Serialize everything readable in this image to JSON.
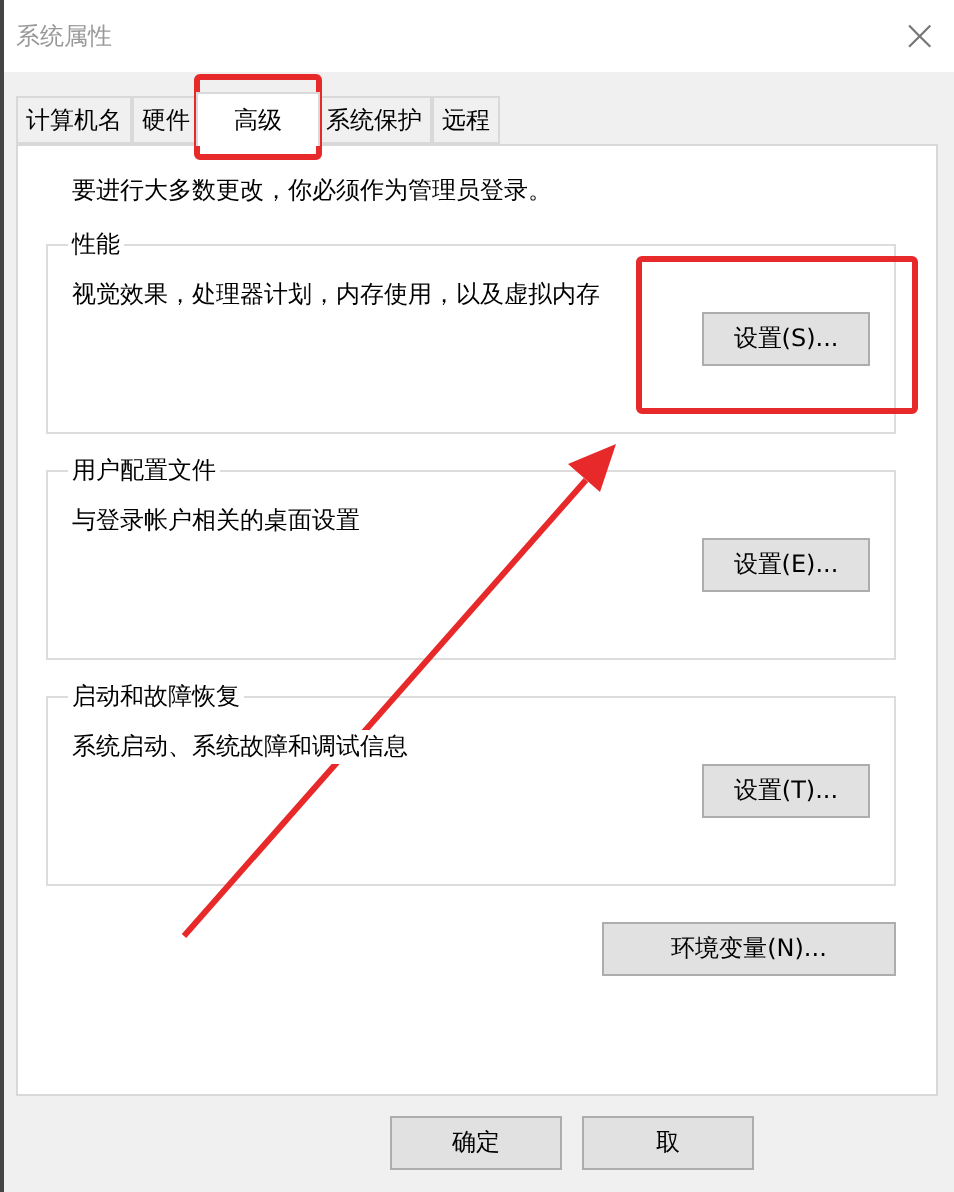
{
  "window": {
    "title": "系统属性",
    "close": "×"
  },
  "tabs": [
    {
      "label": "计算机名",
      "selected": false,
      "highlighted": false
    },
    {
      "label": "硬件",
      "selected": false,
      "highlighted": false
    },
    {
      "label": "高级",
      "selected": true,
      "highlighted": true
    },
    {
      "label": "系统保护",
      "selected": false,
      "highlighted": false
    },
    {
      "label": "远程",
      "selected": false,
      "highlighted": false
    }
  ],
  "notice": "要进行大多数更改，你必须作为管理员登录。",
  "groups": [
    {
      "title": "性能",
      "description": "视觉效果，处理器计划，内存使用，以及虚拟内存",
      "button": "设置(S)...",
      "highlighted": true
    },
    {
      "title": "用户配置文件",
      "description": "与登录帐户相关的桌面设置",
      "button": "设置(E)...",
      "highlighted": false
    },
    {
      "title": "启动和故障恢复",
      "description": "系统启动、系统故障和调试信息",
      "button": "设置(T)...",
      "highlighted": false
    }
  ],
  "env_button": "环境变量(N)...",
  "footer_buttons": [
    "确定",
    "取"
  ],
  "annotation_arrow": true
}
